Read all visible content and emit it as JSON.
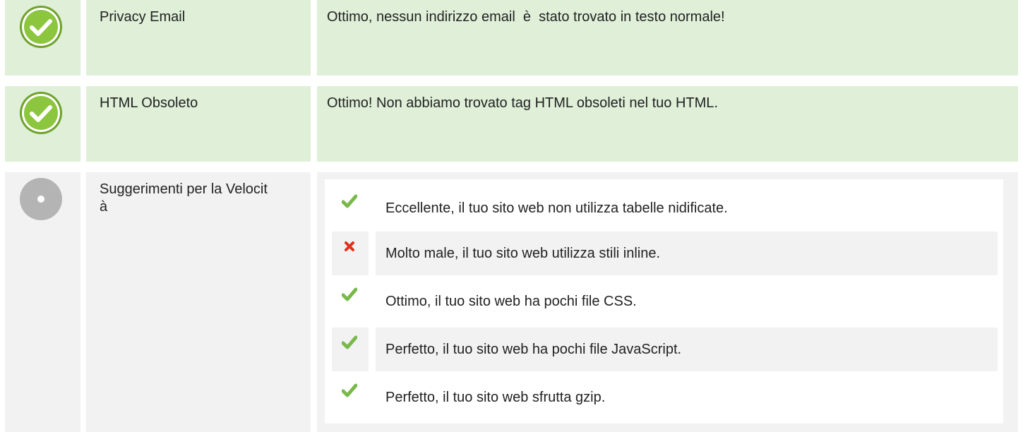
{
  "rows": [
    {
      "name": "Privacy Email",
      "status": "pass",
      "message": "Ottimo, nessun indirizzo email  è  stato trovato in testo normale!"
    },
    {
      "name": "HTML Obsoleto",
      "status": "pass",
      "message": "Ottimo! Non abbiamo trovato tag HTML obsoleti nel tuo HTML."
    },
    {
      "name": "Suggerimenti per la Velocit à",
      "status": "info",
      "tips": [
        {
          "status": "check-icon",
          "text": "Eccellente, il tuo sito web non utilizza tabelle nidificate."
        },
        {
          "status": "cross-icon",
          "text": "Molto male, il tuo sito web utilizza stili inline."
        },
        {
          "status": "check-icon",
          "text": "Ottimo, il tuo sito web ha pochi file CSS."
        },
        {
          "status": "check-icon",
          "text": "Perfetto, il tuo sito web ha pochi file JavaScript."
        },
        {
          "status": "check-icon",
          "text": "Perfetto, il tuo sito web sfrutta gzip."
        }
      ]
    }
  ],
  "colors": {
    "pass_bg": "#dfefd8",
    "info_bg": "#f2f2f2",
    "pass_icon": "#8cc63f",
    "info_icon": "#b4b4b4",
    "check": "#79b94c",
    "cross": "#e0301e"
  }
}
